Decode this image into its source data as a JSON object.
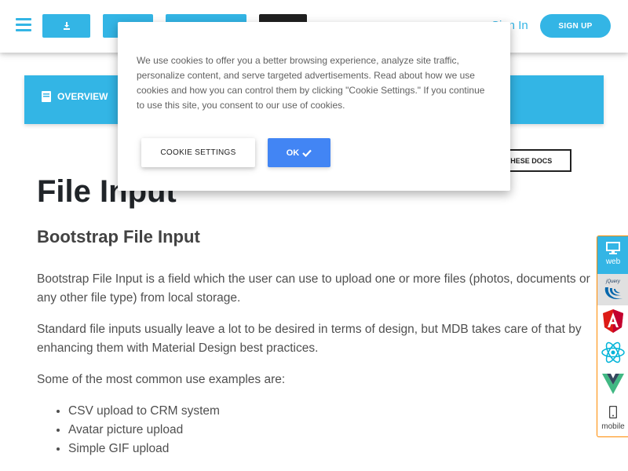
{
  "navbar": {
    "signin_label": "Sign In",
    "signup_label": "SIGN UP"
  },
  "tabs": {
    "overview_label": "OVERVIEW"
  },
  "docs_button_label": "THESE DOCS",
  "content": {
    "title": "File Input",
    "subtitle": "Bootstrap File Input",
    "paragraphs": [
      "Bootstrap File Input is a field which the user can use to upload one or more files (photos, documents or any other file type) from local storage.",
      "Standard file inputs usually leave a lot to be desired in terms of design, but MDB takes care of that by enhancing them with Material Design best practices.",
      "Some of the most common use examples are:"
    ],
    "use_examples": [
      "CSV upload to CRM system",
      "Avatar picture upload",
      "Simple GIF upload"
    ]
  },
  "side_panel": {
    "web_label": "web",
    "jquery_label": "jQuery",
    "mobile_label": "mobile"
  },
  "cookie_modal": {
    "text": "We use cookies to offer you a better browsing experience, analyze site traffic, personalize content, and serve targeted advertisements. Read about how we use cookies and how you can control them by clicking \"Cookie Settings.\" If you continue to use this site, you consent to our use of cookies.",
    "settings_label": "COOKIE SETTINGS",
    "ok_label": "OK"
  },
  "colors": {
    "accent": "#33b5e5",
    "primary": "#4285f4",
    "dark": "#212121",
    "side_border": "#ff8a00",
    "angular": "#dd1b16",
    "react": "#00d8ff",
    "vue_green": "#41b883",
    "vue_dark": "#35495e"
  },
  "icons": [
    "menu-icon",
    "download-icon",
    "book-icon",
    "desktop-icon",
    "jquery-icon",
    "angular-icon",
    "react-icon",
    "vue-icon",
    "mobile-icon",
    "check-icon"
  ]
}
